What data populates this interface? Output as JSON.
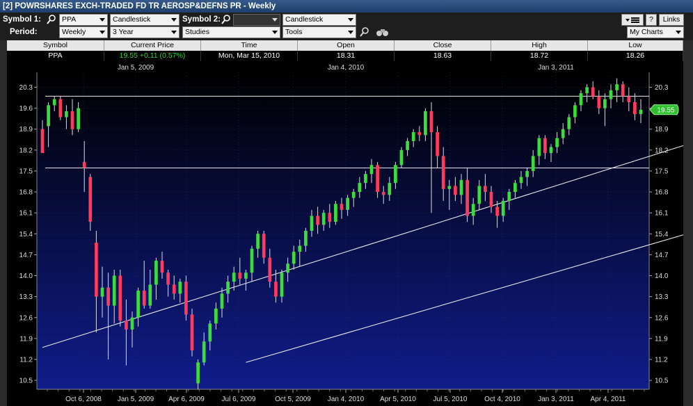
{
  "window": {
    "title": "[2] POWRSHARES EXCH-TRADED FD TR AEROSP&DEFNS PR - Weekly"
  },
  "toolbar": {
    "symbol1_label": "Symbol 1:",
    "symbol1_value": "PPA",
    "chart_type1": "Candlestick",
    "symbol2_label": "Symbol 2:",
    "symbol2_value": "",
    "chart_type2": "Candlestick",
    "period_label": "Period:",
    "period_value": "Weekly",
    "range_value": "3 Year",
    "studies_label": "Studies",
    "tools_label": "Tools",
    "help_label": "?",
    "links_label": "Links",
    "my_charts_label": "My Charts",
    "icons": [
      "search-icon",
      "search-icon",
      "zoom-icon",
      "binoculars-icon",
      "menu-icon"
    ]
  },
  "quote": {
    "headers": [
      "Symbol",
      "Current Price",
      "Time",
      "Open",
      "Close",
      "High",
      "Low"
    ],
    "symbol": "PPA",
    "current_price": "19.55 +0.11 (0.57%)",
    "time": "Mon, Mar 15, 2010",
    "open": "18.31",
    "close": "18.63",
    "high": "18.72",
    "low": "18.26",
    "change_color": "#35d335"
  },
  "chart_data": {
    "type": "candlestick",
    "y_ticks": [
      "10.5",
      "11.2",
      "11.9",
      "12.6",
      "13.3",
      "14.0",
      "14.7",
      "15.4",
      "16.1",
      "16.8",
      "17.5",
      "18.2",
      "18.9",
      "19.6",
      "20.3"
    ],
    "ylim": [
      10.2,
      20.8
    ],
    "x_ticks": [
      "Oct 6, 2008",
      "Jan 5, 2009",
      "Apr 6, 2009",
      "Jul 6, 2009",
      "Oct 5, 2009",
      "Jan 4, 2010",
      "Apr 5, 2010",
      "Jul 5, 2010",
      "Oct 4, 2010",
      "Jan 3, 2011",
      "Apr 4, 2011"
    ],
    "top_labels": [
      "Jan 5, 2009",
      "Jan 4, 2010",
      "Jan 3, 2011"
    ],
    "current_price_tag": "19.55",
    "horizontal_lines": [
      20.0,
      17.6
    ],
    "channel_lines": [
      {
        "from": {
          "week": 0,
          "y": 11.6
        },
        "to": {
          "week": 146,
          "y": 20.8
        }
      },
      {
        "from": {
          "week": 34,
          "y": 11.1
        },
        "to": {
          "week": 166,
          "y": 18.8
        }
      }
    ],
    "up_color": "#3ddc3d",
    "down_color": "#ff3b5c",
    "candles": [
      [
        18.9,
        19.2,
        18.6,
        18.1
      ],
      [
        19.0,
        19.8,
        18.3,
        19.7
      ],
      [
        19.7,
        20.0,
        19.5,
        19.9
      ],
      [
        19.9,
        20.0,
        19.2,
        19.3
      ],
      [
        19.3,
        19.7,
        18.9,
        19.5
      ],
      [
        19.5,
        19.9,
        18.7,
        18.9
      ],
      [
        18.9,
        19.8,
        18.8,
        19.6
      ],
      [
        17.8,
        18.5,
        16.8,
        17.6
      ],
      [
        17.3,
        17.4,
        15.5,
        15.8
      ],
      [
        15.1,
        15.5,
        12.1,
        13.3
      ],
      [
        13.3,
        14.3,
        12.6,
        13.6
      ],
      [
        13.6,
        14.1,
        11.2,
        13.0
      ],
      [
        13.0,
        14.2,
        12.4,
        14.0
      ],
      [
        14.0,
        14.2,
        12.3,
        12.5
      ],
      [
        12.5,
        13.2,
        11.0,
        12.2
      ],
      [
        12.2,
        12.8,
        11.6,
        12.6
      ],
      [
        12.6,
        13.6,
        12.3,
        13.5
      ],
      [
        13.5,
        14.5,
        12.9,
        13.0
      ],
      [
        13.0,
        14.2,
        12.9,
        13.7
      ],
      [
        13.7,
        14.6,
        13.2,
        14.5
      ],
      [
        14.5,
        14.8,
        13.9,
        14.1
      ],
      [
        14.1,
        14.2,
        13.3,
        13.7
      ],
      [
        13.7,
        14.0,
        13.2,
        13.4
      ],
      [
        13.4,
        13.9,
        13.1,
        13.8
      ],
      [
        13.8,
        14.0,
        12.5,
        12.7
      ],
      [
        12.7,
        12.9,
        11.3,
        11.5
      ],
      [
        10.4,
        11.2,
        10.2,
        11.1
      ],
      [
        11.1,
        12.1,
        11.0,
        11.8
      ],
      [
        11.8,
        12.5,
        11.5,
        12.4
      ],
      [
        12.4,
        13.1,
        12.2,
        12.9
      ],
      [
        12.9,
        13.6,
        12.6,
        13.4
      ],
      [
        13.4,
        14.0,
        13.1,
        13.8
      ],
      [
        13.8,
        14.3,
        13.5,
        14.1
      ],
      [
        14.1,
        14.6,
        13.7,
        13.9
      ],
      [
        13.9,
        14.2,
        13.5,
        14.1
      ],
      [
        14.1,
        15.0,
        13.8,
        14.9
      ],
      [
        14.9,
        15.5,
        14.6,
        15.4
      ],
      [
        15.4,
        15.5,
        14.4,
        14.6
      ],
      [
        14.6,
        14.9,
        13.6,
        13.8
      ],
      [
        13.8,
        14.2,
        13.1,
        13.3
      ],
      [
        13.3,
        14.2,
        13.1,
        14.1
      ],
      [
        14.1,
        14.6,
        13.8,
        14.4
      ],
      [
        14.4,
        15.0,
        14.2,
        14.8
      ],
      [
        14.8,
        15.2,
        14.3,
        15.0
      ],
      [
        15.0,
        15.6,
        14.8,
        15.5
      ],
      [
        15.5,
        16.2,
        15.3,
        16.0
      ],
      [
        16.0,
        16.3,
        15.4,
        15.7
      ],
      [
        15.7,
        16.2,
        15.5,
        16.1
      ],
      [
        16.1,
        16.4,
        15.6,
        15.8
      ],
      [
        15.8,
        16.5,
        15.7,
        16.4
      ],
      [
        16.4,
        16.6,
        15.9,
        16.2
      ],
      [
        16.2,
        16.7,
        16.0,
        16.6
      ],
      [
        16.6,
        16.9,
        16.3,
        16.8
      ],
      [
        16.8,
        17.3,
        16.6,
        17.1
      ],
      [
        17.1,
        17.5,
        16.9,
        17.4
      ],
      [
        17.4,
        17.9,
        17.1,
        17.7
      ],
      [
        17.7,
        17.8,
        16.6,
        16.8
      ],
      [
        16.8,
        17.0,
        16.4,
        16.7
      ],
      [
        16.7,
        17.3,
        16.5,
        17.1
      ],
      [
        17.1,
        17.8,
        16.9,
        17.7
      ],
      [
        17.7,
        18.3,
        17.6,
        18.2
      ],
      [
        18.2,
        18.6,
        18.0,
        18.5
      ],
      [
        18.5,
        18.9,
        18.3,
        18.8
      ],
      [
        18.8,
        19.0,
        18.5,
        18.7
      ],
      [
        18.7,
        19.6,
        18.5,
        19.5
      ],
      [
        19.5,
        19.8,
        16.1,
        18.8
      ],
      [
        18.8,
        19.0,
        17.6,
        18.0
      ],
      [
        18.0,
        18.3,
        16.5,
        16.9
      ],
      [
        16.9,
        17.2,
        16.2,
        17.0
      ],
      [
        17.0,
        17.3,
        16.5,
        16.7
      ],
      [
        16.7,
        17.4,
        16.4,
        17.2
      ],
      [
        17.2,
        17.6,
        15.8,
        16.0
      ],
      [
        16.0,
        16.6,
        15.7,
        16.4
      ],
      [
        16.4,
        17.2,
        16.2,
        17.0
      ],
      [
        17.0,
        17.4,
        16.5,
        16.8
      ],
      [
        16.8,
        17.0,
        16.1,
        16.3
      ],
      [
        16.3,
        16.5,
        15.6,
        16.0
      ],
      [
        16.0,
        16.6,
        15.8,
        16.5
      ],
      [
        16.5,
        16.9,
        16.2,
        16.8
      ],
      [
        16.8,
        17.2,
        16.6,
        17.1
      ],
      [
        17.1,
        17.5,
        16.9,
        17.3
      ],
      [
        17.3,
        17.6,
        17.0,
        17.5
      ],
      [
        17.5,
        18.2,
        17.3,
        18.0
      ],
      [
        18.0,
        18.7,
        17.7,
        18.6
      ],
      [
        18.6,
        18.7,
        17.9,
        18.1
      ],
      [
        18.1,
        18.4,
        17.8,
        18.3
      ],
      [
        18.3,
        18.8,
        18.1,
        18.6
      ],
      [
        18.6,
        19.1,
        18.4,
        18.9
      ],
      [
        18.9,
        19.4,
        18.7,
        19.3
      ],
      [
        19.3,
        19.8,
        19.1,
        19.7
      ],
      [
        19.7,
        20.2,
        19.5,
        20.1
      ],
      [
        20.1,
        20.4,
        19.8,
        20.3
      ],
      [
        20.3,
        20.5,
        19.9,
        20.0
      ],
      [
        20.0,
        20.2,
        19.4,
        19.6
      ],
      [
        19.6,
        20.1,
        19.0,
        19.9
      ],
      [
        19.9,
        20.4,
        19.6,
        20.2
      ],
      [
        20.2,
        20.6,
        19.8,
        20.4
      ],
      [
        20.4,
        20.5,
        19.8,
        20.0
      ],
      [
        20.0,
        20.3,
        19.5,
        19.8
      ],
      [
        19.8,
        20.1,
        19.2,
        19.4
      ],
      [
        19.4,
        19.9,
        19.1,
        19.55
      ]
    ]
  }
}
